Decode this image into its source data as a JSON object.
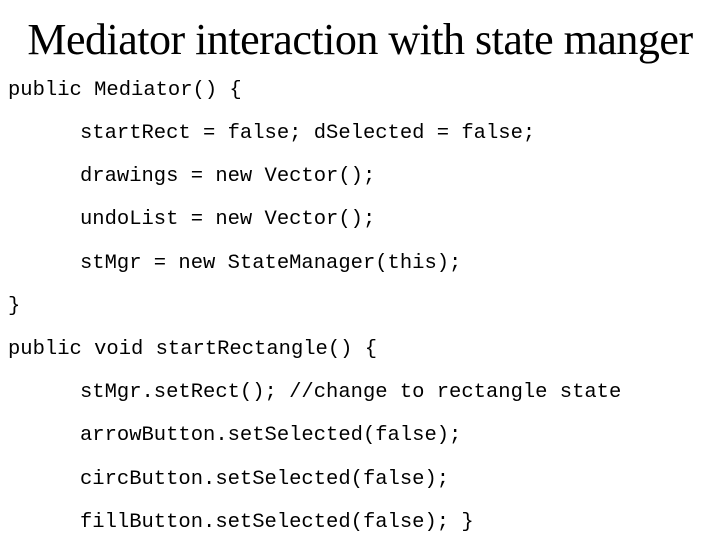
{
  "slide": {
    "title": "Mediator interaction with state manger",
    "code_lines": [
      {
        "indent": 0,
        "text": "public Mediator() {"
      },
      {
        "indent": 1,
        "text": "startRect = false; dSelected = false;"
      },
      {
        "indent": 1,
        "text": "drawings = new Vector();"
      },
      {
        "indent": 1,
        "text": "undoList = new Vector();"
      },
      {
        "indent": 1,
        "text": "stMgr = new StateManager(this);"
      },
      {
        "indent": 0,
        "text": "}"
      },
      {
        "indent": 0,
        "text": "public void startRectangle() {"
      },
      {
        "indent": 1,
        "text": "stMgr.setRect(); //change to rectangle state"
      },
      {
        "indent": 1,
        "text": "arrowButton.setSelected(false);"
      },
      {
        "indent": 1,
        "text": "circButton.setSelected(false);"
      },
      {
        "indent": 1,
        "text": "fillButton.setSelected(false); }"
      }
    ]
  }
}
